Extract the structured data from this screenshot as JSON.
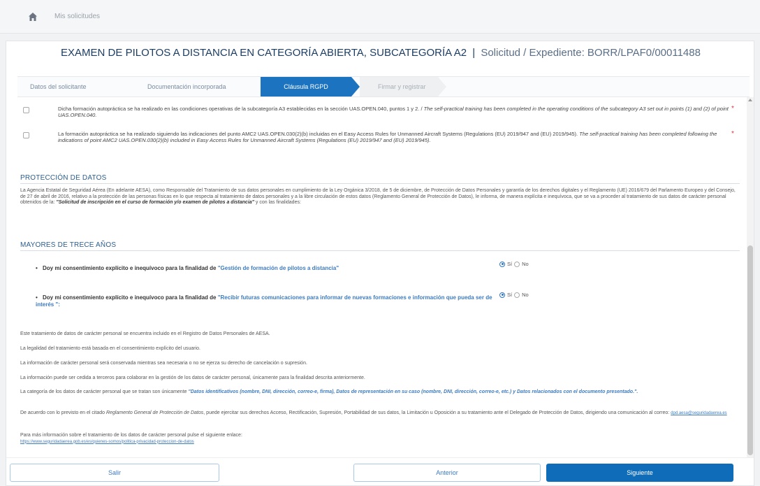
{
  "breadcrumb": {
    "label": "Mis solicitudes"
  },
  "header": {
    "title": "EXAMEN DE PILOTOS A DISTANCIA EN CATEGORÍA ABIERTA, SUBCATEGORÍA A2",
    "separator": "|",
    "subtitle": "Solicitud / Expediente: BORR/LPAF0/00011488"
  },
  "steps": [
    {
      "label": "Datos del solicitante",
      "state": "done"
    },
    {
      "label": "Documentación incorporada",
      "state": "done"
    },
    {
      "label": "Cláusula RGPD",
      "state": "active"
    },
    {
      "label": "Firmar y registrar",
      "state": "disabled"
    }
  ],
  "checks": [
    {
      "text": "Dicha formación autopráctica se ha realizado en las condiciones operativas de la subcategoría A3 establecidas en la sección UAS.OPEN.040, puntos 1 y 2. / ",
      "text_en": "The self-practical training has been completed in the operating conditions of the subcategory A3 set out in points (1) and (2) of point UAS.OPEN.040.",
      "required": "*"
    },
    {
      "text": "La formación autopráctica se ha realizado siguiendo las indicaciones del punto AMC2 UAS.OPEN.030(2)(b) incluidas en el Easy Access Rules for Unmanned Aircraft Systems (Regulations (EU) 2019/947 and (EU) 2019/945). ",
      "text_en": "The self-practical training has been completed following the indications of point AMC2 UAS.OPEN.030(2)(b) included in Easy Access Rules for Unmanned Aircraft Systems (Regulations (EU) 2019/947 and (EU) 2019/945).",
      "required": "*"
    }
  ],
  "data_protection": {
    "title": "PROTECCIÓN DE DATOS",
    "text": "La Agencia Estatal de Seguridad Aérea (En adelante AESA), como Responsable del Tratamiento de sus datos personales en cumplimiento de la Ley Orgánica 3/2018, de 5 de diciembre, de Protección de Datos Personales y garantía de los derechos digitales y el Reglamento (UE) 2016/679 del Parlamento Europeo y del Consejo, de 27 de abril de 2016, relativo a la protección de las personas físicas en lo que respecta al tratamiento de datos personales y a la libre circulación de estos datos (Reglamento General de Protección de Datos), le informa, de manera explícita e inequívoca, que se va a proceder al tratamiento de sus datos de carácter personal obtenidos de la: ",
    "bold_text": "\"Solicitud de inscripción en el curso de formación y/o examen de pilotos a distancia\"",
    "tail": " y con las finalidades:"
  },
  "over_thirteen": {
    "title": "MAYORES DE TRECE AÑOS",
    "consents": [
      {
        "prefix": "Doy mi consentimiento explícito e inequívoco para la finalidad de",
        "purpose": "\"Gestión de formación de pilotos a distancia\"",
        "yes": "Sí",
        "no": "No",
        "selected": "yes"
      },
      {
        "prefix": "Doy mi consentimiento explícito e inequívoco para la finalidad de",
        "purpose": "\"Recibir futuras comunicaciones para informar de nuevas formaciones e información que pueda ser de interés \":",
        "yes": "Sí",
        "no": "No",
        "selected": "yes"
      }
    ]
  },
  "info": {
    "p1": "Este tratamiento de datos de carácter personal se encuentra incluido en el Registro de Datos Personales de AESA.",
    "p2": "La legalidad del tratamiento está basada en el consentimiento explícito del usuario.",
    "p3": "La información de carácter personal será conservada mientras sea necesaria o no se ejerza su derecho de cancelación o supresión.",
    "p4": "La información puede ser cedida a terceros para colaborar en la gestión de los datos de carácter personal, únicamente para la finalidad descrita anteriormente.",
    "p5_prefix": "La categoría de los datos de carácter personal que se tratan son únicamente ",
    "p5_blue": "\"Datos identificativos (nombre, DNI, dirección, correo-e, firma), Datos de representación en su caso (nombre, DNI, dirección, correo-e, etc.) y Datos relacionados con el documento presentado.\".",
    "p6_a": "De acuerdo con lo previsto en el citado ",
    "p6_italic": "Reglamento General de Protección de Datos",
    "p6_b": ", puede ejercitar sus derechos Acceso, Rectificación, Supresión, Portabilidad de sus datos, la Limitación u Oposición a su tratamiento ante el Delegado de Protección de Datos, dirigiendo una comunicación al correo: ",
    "p6_email": "dpd.aesa@seguridadaerea.es",
    "p7": "Para más información sobre el tratamiento de los datos de carácter personal pulse el siguiente enlace:",
    "p7_link": "https://www.seguridadaerea.gob.es/es/quienes-somos/politica-privacidad-proteccion-de-datos"
  },
  "footer": {
    "exit_label": "Salir",
    "prev_label": "Anterior",
    "next_label": "Siguiente"
  }
}
